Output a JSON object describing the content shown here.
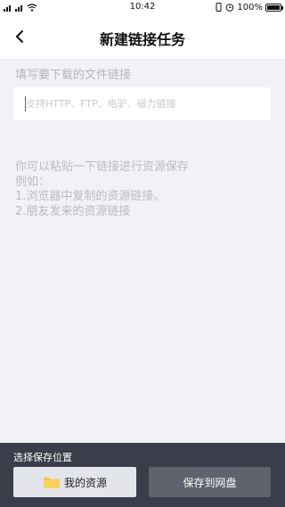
{
  "status_bar": {
    "signal_left": "4G",
    "time": "10:42",
    "battery": "100%",
    "battery_level": 1.0,
    "icons": [
      "signal-icon",
      "wifi-icon",
      "vibrate-icon",
      "alarm-icon",
      "battery-icon"
    ]
  },
  "header": {
    "title": "新建链接任务",
    "back_icon": "chevron-left-icon"
  },
  "form": {
    "label": "填写要下载的文件链接",
    "placeholder": "支持HTTP、FTP、电驴、磁力链接",
    "value": ""
  },
  "hints": {
    "line1": "你可以粘贴一下链接进行资源保存",
    "line2": "例如：",
    "line3": "1.浏览器中复制的资源链接。",
    "line4": "2.朋友发来的资源链接"
  },
  "footer": {
    "label": "选择保存位置",
    "my_resources_label": "我的资源",
    "my_resources_icon": "folder-icon",
    "save_cloud_label": "保存到网盘"
  },
  "colors": {
    "background": "#f1f2f5",
    "panel": "#3a3d4a",
    "folder": "#f5c441"
  }
}
